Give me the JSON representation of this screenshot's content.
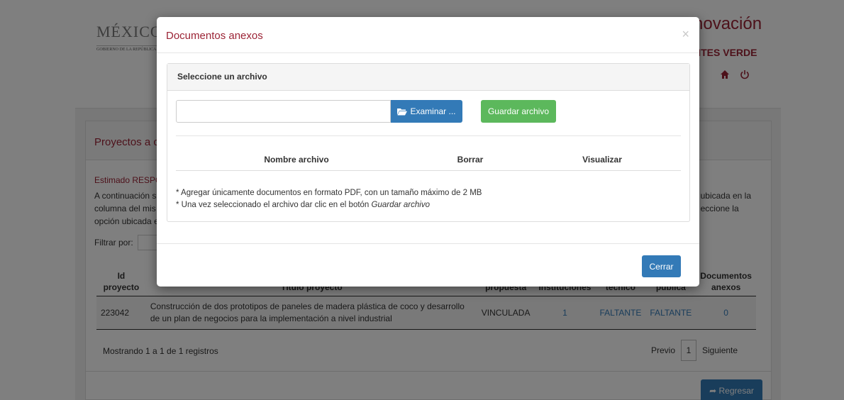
{
  "header": {
    "logo_main": "MÉXICO",
    "logo_sub": "GOBIERNO DE LA REPÚBLICA",
    "brand_title": "novación",
    "brand_sub": "NTES VERDE"
  },
  "panel": {
    "title": "Proyectos a c",
    "greeting": "Estimado RESPO",
    "intro_left": "A continuación s\ncolumna del mis\nopción ubicada e",
    "intro_right": "ubicada en la\neccione la",
    "filter_label": "Filtrar por:"
  },
  "table": {
    "headers": {
      "id": "Id proyecto",
      "title": "Título proyecto",
      "status": "propuesta",
      "institutions": "Instituciones",
      "technical": "técnico",
      "public": "pública",
      "documents": "Documentos anexos"
    },
    "rows": [
      {
        "id": "223042",
        "title": "Construcción de dos prototipos de paneles de madera plástica de coco y desarrollo de un plan de negocios para la implementación a nivel industrial",
        "status": "VINCULADA",
        "institutions": "1",
        "technical": "FALTANTE",
        "public": "FALTANTE",
        "documents": "0"
      }
    ],
    "footer_info": "Mostrando 1 a 1 de 1 registros",
    "pager": {
      "prev": "Previo",
      "page": "1",
      "next": "Siguiente"
    }
  },
  "back_button": "Regresar",
  "modal": {
    "title": "Documentos anexos",
    "close_symbol": "×",
    "section_title": "Seleccione un archivo",
    "browse_label": "Examinar ...",
    "save_label": "Guardar archivo",
    "columns": [
      "Nombre archivo",
      "Borrar",
      "Visualizar"
    ],
    "note1": "* Agregar únicamente documentos en formato PDF, con un tamaño máximo de 2 MB",
    "note2_prefix": "* Una vez seleccionado el archivo dar clic en el botón ",
    "note2_emph": "Guardar archivo",
    "close_button": "Cerrar"
  },
  "colors": {
    "brand": "#9b2335",
    "primary": "#337ab7",
    "success": "#5cb85c"
  }
}
